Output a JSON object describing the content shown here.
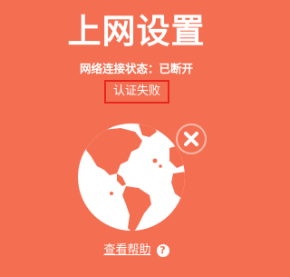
{
  "page": {
    "title": "上网设置",
    "status_text": "网络连接状态：已断开",
    "error_text": "认证失败",
    "help_link": "查看帮助",
    "help_icon_glyph": "?"
  },
  "icons": {
    "globe": "globe-icon",
    "disconnect": "close-icon",
    "help": "question-icon"
  },
  "colors": {
    "background": "#f46f52",
    "error_border": "#e8261f",
    "foreground": "#ffffff"
  }
}
